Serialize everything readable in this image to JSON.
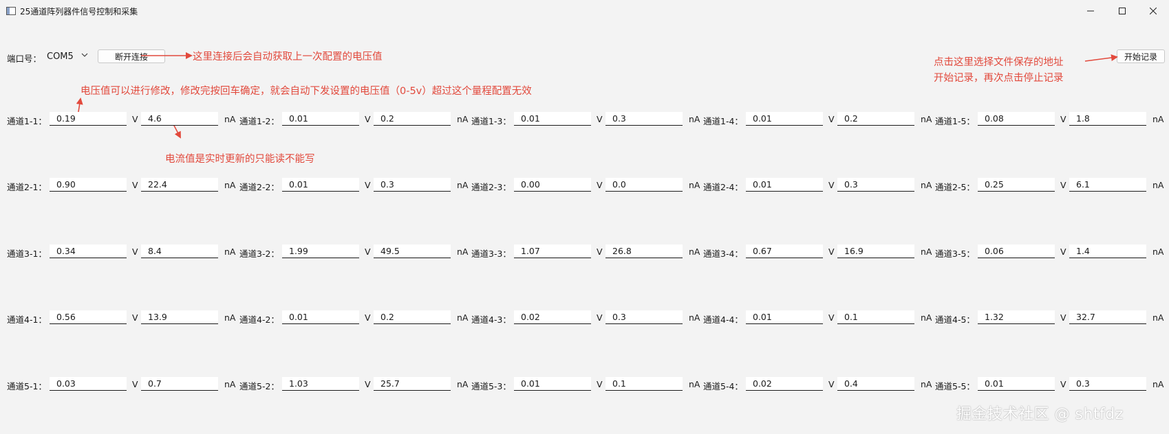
{
  "window": {
    "title": "25通道阵列器件信号控制和采集"
  },
  "toolbar": {
    "port_label": "端口号：",
    "port_value": "COM5",
    "disconnect_label": "断开连接",
    "record_label": "开始记录"
  },
  "annotations": {
    "connect_note": "这里连接后会自动获取上一次配置的电压值",
    "record_note_1": "点击这里选择文件保存的地址",
    "record_note_2": "开始记录，再次点击停止记录",
    "voltage_note": "电压值可以进行修改，修改完按回车确定，就会自动下发设置的电压值（0-5v）超过这个量程配置无效",
    "current_note": "电流值是实时更新的只能读不能写"
  },
  "units": {
    "voltage": "V",
    "current": "nA"
  },
  "channels": [
    [
      {
        "label": "通道1-1：",
        "voltage": "0.19",
        "current": "4.6"
      },
      {
        "label": "通道1-2：",
        "voltage": "0.01",
        "current": "0.2"
      },
      {
        "label": "通道1-3：",
        "voltage": "0.01",
        "current": "0.3"
      },
      {
        "label": "通道1-4：",
        "voltage": "0.01",
        "current": "0.2"
      },
      {
        "label": "通道1-5：",
        "voltage": "0.08",
        "current": "1.8"
      }
    ],
    [
      {
        "label": "通道2-1：",
        "voltage": "0.90",
        "current": "22.4"
      },
      {
        "label": "通道2-2：",
        "voltage": "0.01",
        "current": "0.3"
      },
      {
        "label": "通道2-3：",
        "voltage": "0.00",
        "current": "0.0"
      },
      {
        "label": "通道2-4：",
        "voltage": "0.01",
        "current": "0.3"
      },
      {
        "label": "通道2-5：",
        "voltage": "0.25",
        "current": "6.1"
      }
    ],
    [
      {
        "label": "通道3-1：",
        "voltage": "0.34",
        "current": "8.4"
      },
      {
        "label": "通道3-2：",
        "voltage": "1.99",
        "current": "49.5"
      },
      {
        "label": "通道3-3：",
        "voltage": "1.07",
        "current": "26.8"
      },
      {
        "label": "通道3-4：",
        "voltage": "0.67",
        "current": "16.9"
      },
      {
        "label": "通道3-5：",
        "voltage": "0.06",
        "current": "1.4"
      }
    ],
    [
      {
        "label": "通道4-1：",
        "voltage": "0.56",
        "current": "13.9"
      },
      {
        "label": "通道4-2：",
        "voltage": "0.01",
        "current": "0.2"
      },
      {
        "label": "通道4-3：",
        "voltage": "0.02",
        "current": "0.3"
      },
      {
        "label": "通道4-4：",
        "voltage": "0.01",
        "current": "0.1"
      },
      {
        "label": "通道4-5：",
        "voltage": "1.32",
        "current": "32.7"
      }
    ],
    [
      {
        "label": "通道5-1：",
        "voltage": "0.03",
        "current": "0.7"
      },
      {
        "label": "通道5-2：",
        "voltage": "1.03",
        "current": "25.7"
      },
      {
        "label": "通道5-3：",
        "voltage": "0.01",
        "current": "0.1"
      },
      {
        "label": "通道5-4：",
        "voltage": "0.02",
        "current": "0.4"
      },
      {
        "label": "通道5-5：",
        "voltage": "0.01",
        "current": "0.3"
      }
    ]
  ],
  "watermark": "掘金技术社区 @ shtfdz",
  "colors": {
    "annotation": "#e2493c",
    "background": "#f3f3f3"
  }
}
